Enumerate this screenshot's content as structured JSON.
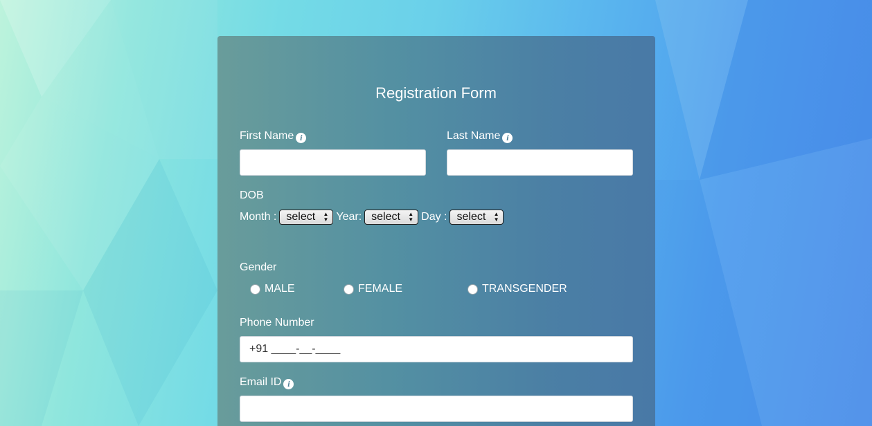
{
  "form": {
    "title": "Registration Form",
    "first_name": {
      "label": "First Name",
      "value": "",
      "info_icon": "info-icon"
    },
    "last_name": {
      "label": "Last Name",
      "value": "",
      "info_icon": "info-icon"
    },
    "dob": {
      "label": "DOB",
      "month_label": "Month :",
      "month_value": "select",
      "year_label": "Year:",
      "year_value": "select",
      "day_label": "Day :",
      "day_value": "select"
    },
    "gender": {
      "label": "Gender",
      "options": [
        "MALE",
        "FEMALE",
        "TRANSGENDER"
      ]
    },
    "phone": {
      "label": "Phone Number",
      "placeholder": "+91 ____-__-____"
    },
    "email": {
      "label": "Email ID",
      "value": "",
      "info_icon": "info-icon"
    }
  },
  "colors": {
    "panel": "#5a8a9c",
    "background_left": "#bdf3dc",
    "background_right": "#4a8de9",
    "text": "#ffffff"
  }
}
